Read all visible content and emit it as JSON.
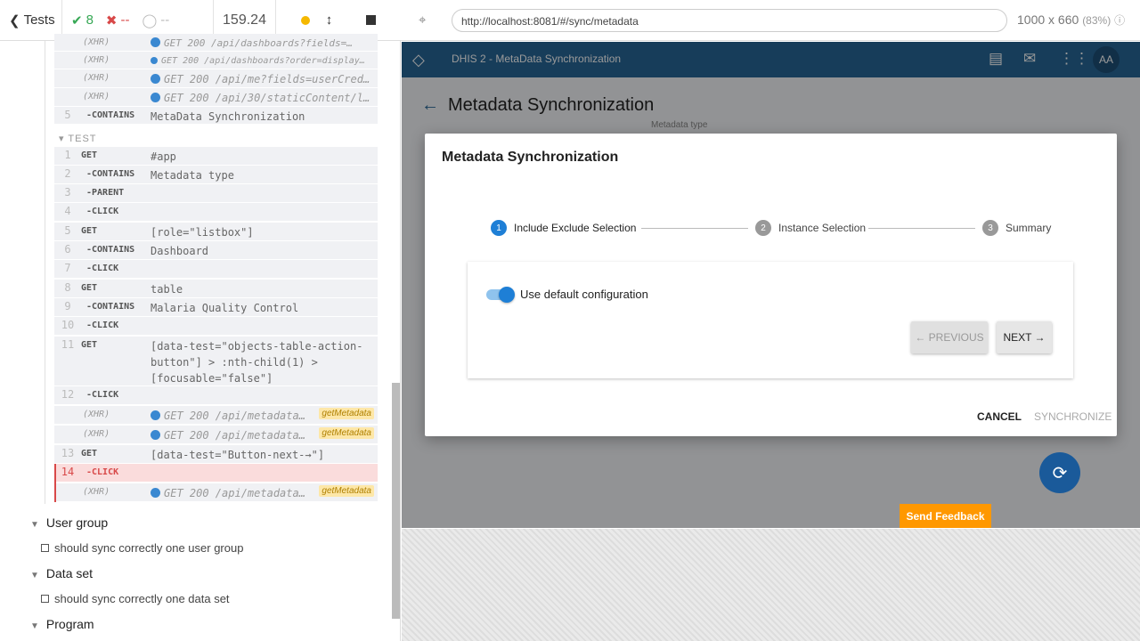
{
  "topbar": {
    "tests_label": "Tests",
    "passed": "8",
    "failed": "--",
    "pending": "--",
    "duration": "159.24"
  },
  "log": {
    "xhr_rows_top": [
      {
        "name": "(XHR)",
        "msg": "GET 200 /api/dashboards?fields=…"
      },
      {
        "name": "(XHR)",
        "msg": "GET 200 /api/dashboards?order=display…"
      },
      {
        "name": "(XHR)",
        "msg": "GET 200 /api/me?fields=userCred…"
      },
      {
        "name": "(XHR)",
        "msg": "GET 200 /api/30/staticContent/l…"
      }
    ],
    "row5": {
      "num": "5",
      "name": "-CONTAINS",
      "msg": "MetaData Synchronization"
    },
    "test_label": "TEST",
    "commands": [
      {
        "num": "1",
        "name": "GET",
        "msg": "#app"
      },
      {
        "num": "2",
        "name": "-CONTAINS",
        "msg": "Metadata type"
      },
      {
        "num": "3",
        "name": "-PARENT",
        "msg": ""
      },
      {
        "num": "4",
        "name": "-CLICK",
        "msg": ""
      },
      {
        "num": "5",
        "name": "GET",
        "msg": "[role=\"listbox\"]"
      },
      {
        "num": "6",
        "name": "-CONTAINS",
        "msg": "Dashboard"
      },
      {
        "num": "7",
        "name": "-CLICK",
        "msg": ""
      },
      {
        "num": "8",
        "name": "GET",
        "msg": "table"
      },
      {
        "num": "9",
        "name": "-CONTAINS",
        "msg": "Malaria Quality Control"
      },
      {
        "num": "10",
        "name": "-CLICK",
        "msg": ""
      },
      {
        "num": "11",
        "name": "GET",
        "msg1": "[data-test=\"objects-table-action-",
        "msg2": "button\"] > :nth-child(1) >",
        "msg3": "[focusable=\"false\"]"
      },
      {
        "num": "12",
        "name": "-CLICK",
        "msg": ""
      }
    ],
    "xhr_mid": [
      {
        "name": "(XHR)",
        "msg": "GET 200 /api/metadata…",
        "alias": "getMetadata"
      },
      {
        "name": "(XHR)",
        "msg": "GET 200 /api/metadata…",
        "alias": "getMetadata"
      }
    ],
    "row13": {
      "num": "13",
      "name": "GET",
      "msg": "[data-test=\"Button-next-→\"]"
    },
    "row14": {
      "num": "14",
      "name": "-CLICK",
      "msg": ""
    },
    "xhr_last": {
      "name": "(XHR)",
      "msg": "GET 200 /api/metadata…",
      "alias": "getMetadata"
    }
  },
  "suites": [
    {
      "title": "User group",
      "test": "should sync correctly one user group"
    },
    {
      "title": "Data set",
      "test": "should sync correctly one data set"
    },
    {
      "title": "Program"
    }
  ],
  "browser": {
    "url": "http://localhost:8081/#/sync/metadata",
    "viewport": "1000 x 660",
    "scale": "(83%)"
  },
  "app": {
    "header_title": "DHIS 2 - MetaData Synchronization",
    "avatar": "AA",
    "page_title": "Metadata Synchronization",
    "bg_label": "Metadata type"
  },
  "modal": {
    "title": "Metadata Synchronization",
    "steps": [
      {
        "num": "1",
        "label": "Include Exclude Selection"
      },
      {
        "num": "2",
        "label": "Instance Selection"
      },
      {
        "num": "3",
        "label": "Summary"
      }
    ],
    "toggle_label": "Use default configuration",
    "prev": "← PREVIOUS",
    "next": "NEXT →",
    "cancel": "CANCEL",
    "synchronize": "SYNCHRONIZE"
  },
  "feedback": "Send Feedback",
  "colors": {
    "accent": "#1e7fd6",
    "header": "#276696",
    "fail": "#d84848",
    "pass": "#37a855",
    "feedback": "#ff9800"
  }
}
